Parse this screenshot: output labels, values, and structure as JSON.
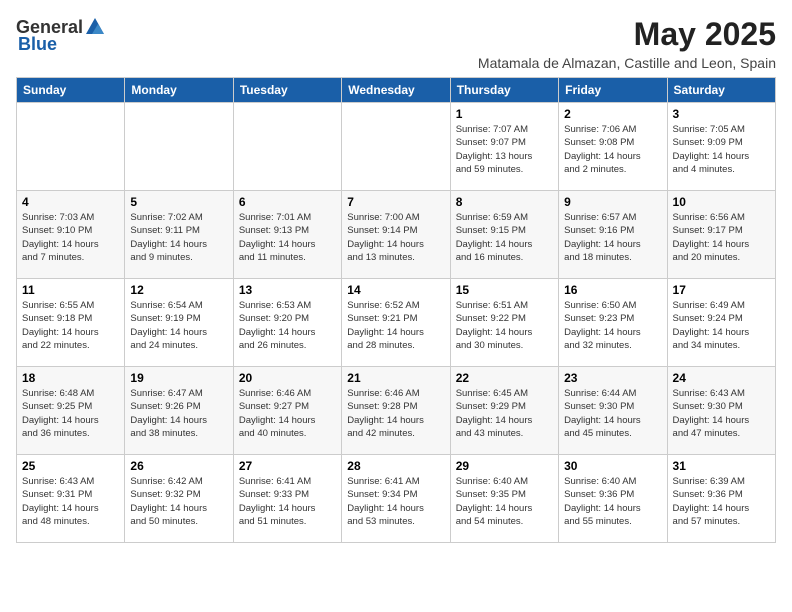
{
  "header": {
    "logo_general": "General",
    "logo_blue": "Blue",
    "month": "May 2025",
    "location": "Matamala de Almazan, Castille and Leon, Spain"
  },
  "weekdays": [
    "Sunday",
    "Monday",
    "Tuesday",
    "Wednesday",
    "Thursday",
    "Friday",
    "Saturday"
  ],
  "weeks": [
    [
      {
        "day": "",
        "info": ""
      },
      {
        "day": "",
        "info": ""
      },
      {
        "day": "",
        "info": ""
      },
      {
        "day": "",
        "info": ""
      },
      {
        "day": "1",
        "info": "Sunrise: 7:07 AM\nSunset: 9:07 PM\nDaylight: 13 hours\nand 59 minutes."
      },
      {
        "day": "2",
        "info": "Sunrise: 7:06 AM\nSunset: 9:08 PM\nDaylight: 14 hours\nand 2 minutes."
      },
      {
        "day": "3",
        "info": "Sunrise: 7:05 AM\nSunset: 9:09 PM\nDaylight: 14 hours\nand 4 minutes."
      }
    ],
    [
      {
        "day": "4",
        "info": "Sunrise: 7:03 AM\nSunset: 9:10 PM\nDaylight: 14 hours\nand 7 minutes."
      },
      {
        "day": "5",
        "info": "Sunrise: 7:02 AM\nSunset: 9:11 PM\nDaylight: 14 hours\nand 9 minutes."
      },
      {
        "day": "6",
        "info": "Sunrise: 7:01 AM\nSunset: 9:13 PM\nDaylight: 14 hours\nand 11 minutes."
      },
      {
        "day": "7",
        "info": "Sunrise: 7:00 AM\nSunset: 9:14 PM\nDaylight: 14 hours\nand 13 minutes."
      },
      {
        "day": "8",
        "info": "Sunrise: 6:59 AM\nSunset: 9:15 PM\nDaylight: 14 hours\nand 16 minutes."
      },
      {
        "day": "9",
        "info": "Sunrise: 6:57 AM\nSunset: 9:16 PM\nDaylight: 14 hours\nand 18 minutes."
      },
      {
        "day": "10",
        "info": "Sunrise: 6:56 AM\nSunset: 9:17 PM\nDaylight: 14 hours\nand 20 minutes."
      }
    ],
    [
      {
        "day": "11",
        "info": "Sunrise: 6:55 AM\nSunset: 9:18 PM\nDaylight: 14 hours\nand 22 minutes."
      },
      {
        "day": "12",
        "info": "Sunrise: 6:54 AM\nSunset: 9:19 PM\nDaylight: 14 hours\nand 24 minutes."
      },
      {
        "day": "13",
        "info": "Sunrise: 6:53 AM\nSunset: 9:20 PM\nDaylight: 14 hours\nand 26 minutes."
      },
      {
        "day": "14",
        "info": "Sunrise: 6:52 AM\nSunset: 9:21 PM\nDaylight: 14 hours\nand 28 minutes."
      },
      {
        "day": "15",
        "info": "Sunrise: 6:51 AM\nSunset: 9:22 PM\nDaylight: 14 hours\nand 30 minutes."
      },
      {
        "day": "16",
        "info": "Sunrise: 6:50 AM\nSunset: 9:23 PM\nDaylight: 14 hours\nand 32 minutes."
      },
      {
        "day": "17",
        "info": "Sunrise: 6:49 AM\nSunset: 9:24 PM\nDaylight: 14 hours\nand 34 minutes."
      }
    ],
    [
      {
        "day": "18",
        "info": "Sunrise: 6:48 AM\nSunset: 9:25 PM\nDaylight: 14 hours\nand 36 minutes."
      },
      {
        "day": "19",
        "info": "Sunrise: 6:47 AM\nSunset: 9:26 PM\nDaylight: 14 hours\nand 38 minutes."
      },
      {
        "day": "20",
        "info": "Sunrise: 6:46 AM\nSunset: 9:27 PM\nDaylight: 14 hours\nand 40 minutes."
      },
      {
        "day": "21",
        "info": "Sunrise: 6:46 AM\nSunset: 9:28 PM\nDaylight: 14 hours\nand 42 minutes."
      },
      {
        "day": "22",
        "info": "Sunrise: 6:45 AM\nSunset: 9:29 PM\nDaylight: 14 hours\nand 43 minutes."
      },
      {
        "day": "23",
        "info": "Sunrise: 6:44 AM\nSunset: 9:30 PM\nDaylight: 14 hours\nand 45 minutes."
      },
      {
        "day": "24",
        "info": "Sunrise: 6:43 AM\nSunset: 9:30 PM\nDaylight: 14 hours\nand 47 minutes."
      }
    ],
    [
      {
        "day": "25",
        "info": "Sunrise: 6:43 AM\nSunset: 9:31 PM\nDaylight: 14 hours\nand 48 minutes."
      },
      {
        "day": "26",
        "info": "Sunrise: 6:42 AM\nSunset: 9:32 PM\nDaylight: 14 hours\nand 50 minutes."
      },
      {
        "day": "27",
        "info": "Sunrise: 6:41 AM\nSunset: 9:33 PM\nDaylight: 14 hours\nand 51 minutes."
      },
      {
        "day": "28",
        "info": "Sunrise: 6:41 AM\nSunset: 9:34 PM\nDaylight: 14 hours\nand 53 minutes."
      },
      {
        "day": "29",
        "info": "Sunrise: 6:40 AM\nSunset: 9:35 PM\nDaylight: 14 hours\nand 54 minutes."
      },
      {
        "day": "30",
        "info": "Sunrise: 6:40 AM\nSunset: 9:36 PM\nDaylight: 14 hours\nand 55 minutes."
      },
      {
        "day": "31",
        "info": "Sunrise: 6:39 AM\nSunset: 9:36 PM\nDaylight: 14 hours\nand 57 minutes."
      }
    ]
  ]
}
